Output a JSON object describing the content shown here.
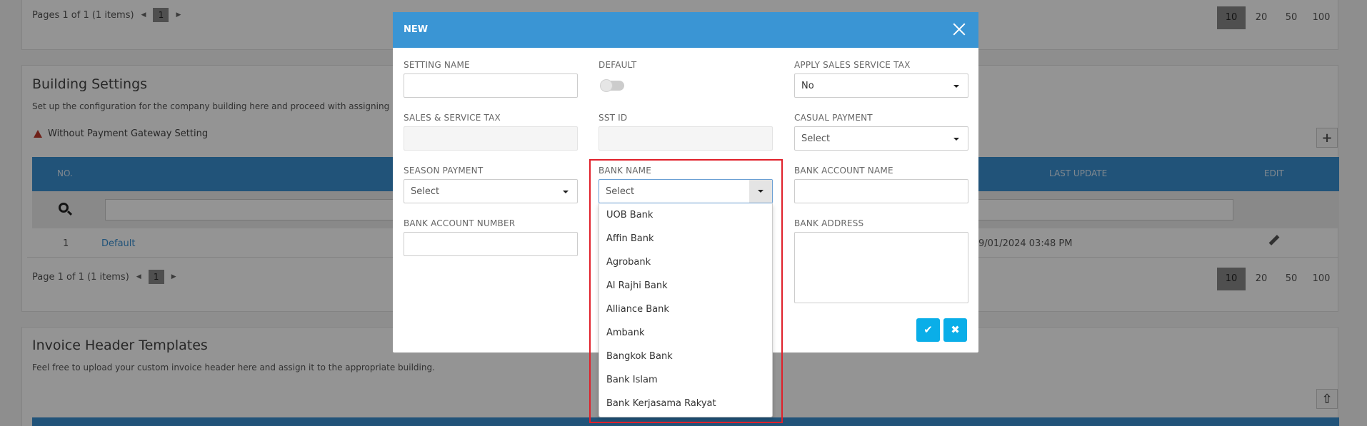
{
  "top_pager": {
    "info": "Pages 1 of 1 (1 items)",
    "current_page": "1",
    "page_sizes": [
      "10",
      "20",
      "50",
      "100"
    ],
    "active_size": "10"
  },
  "building_settings": {
    "title": "Building Settings",
    "description": "Set up the configuration for the company building here and proceed with assigning it t",
    "warning": "Without Payment Gateway Setting",
    "columns": {
      "no": "NO.",
      "last_update": "LAST UPDATE",
      "edit": "EDIT"
    },
    "row": {
      "no": "1",
      "name": "Default",
      "last_update": "9/01/2024 03:48 PM"
    },
    "pager": {
      "info": "Page 1 of 1 (1 items)",
      "current_page": "1",
      "page_sizes": [
        "10",
        "20",
        "50",
        "100"
      ]
    }
  },
  "invoice_templates": {
    "title": "Invoice Header Templates",
    "description": "Feel free to upload your custom invoice header here and assign it to the appropriate building."
  },
  "modal": {
    "title": "NEW",
    "fields": {
      "setting_name": {
        "label": "SETTING NAME",
        "value": ""
      },
      "default": {
        "label": "DEFAULT",
        "value": false
      },
      "apply_sst": {
        "label": "APPLY SALES SERVICE TAX",
        "value": "No"
      },
      "sales_service_tax": {
        "label": "SALES & SERVICE TAX",
        "value": ""
      },
      "sst_id": {
        "label": "SST ID",
        "value": ""
      },
      "casual_payment": {
        "label": "CASUAL PAYMENT",
        "value": "Select"
      },
      "season_payment": {
        "label": "SEASON PAYMENT",
        "value": "Select"
      },
      "bank_name": {
        "label": "BANK NAME",
        "value": "Select"
      },
      "bank_account_name": {
        "label": "BANK ACCOUNT NAME",
        "value": ""
      },
      "bank_account_number": {
        "label": "BANK ACCOUNT NUMBER",
        "value": ""
      },
      "bank_address": {
        "label": "BANK ADDRESS",
        "value": ""
      }
    },
    "bank_options": [
      "UOB Bank",
      "Affin Bank",
      "Agrobank",
      "Al Rajhi Bank",
      "Alliance Bank",
      "Ambank",
      "Bangkok Bank",
      "Bank Islam",
      "Bank Kerjasama Rakyat"
    ],
    "colors": {
      "header": "#3a95d4",
      "action": "#0aaee8",
      "highlight": "#e0202a"
    }
  }
}
